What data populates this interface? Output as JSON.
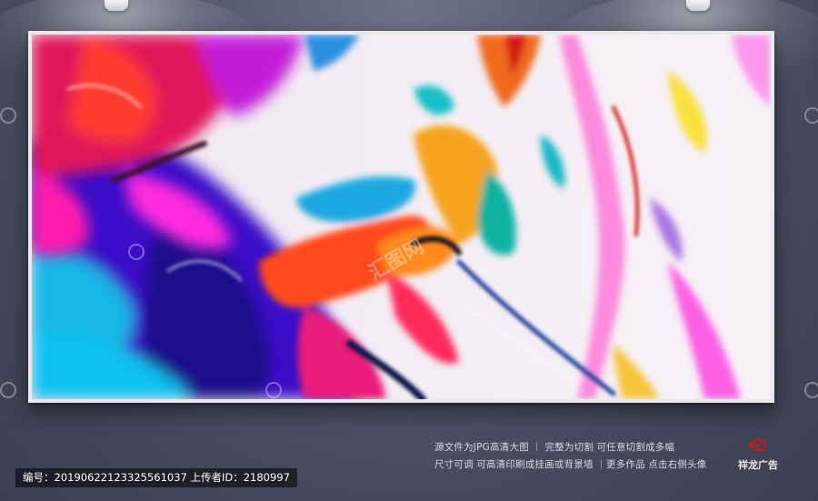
{
  "watermark": {
    "text": "汇图网"
  },
  "info": {
    "line1": "源文件为JPG高清大图 ｜ 完整为切割 可任意切割成多幅",
    "line2": "尺寸可调 可高清印刷成挂画或背景墙 ｜更多作品 点击右侧头像"
  },
  "id_bar": {
    "text": "编号：20190622123325561037 上传者ID：2180997"
  },
  "logo": {
    "text": "祥龙广告",
    "color": "#c8191e"
  },
  "colors": {
    "wall": "#4a4d60",
    "frame": "#e9e9ec"
  }
}
